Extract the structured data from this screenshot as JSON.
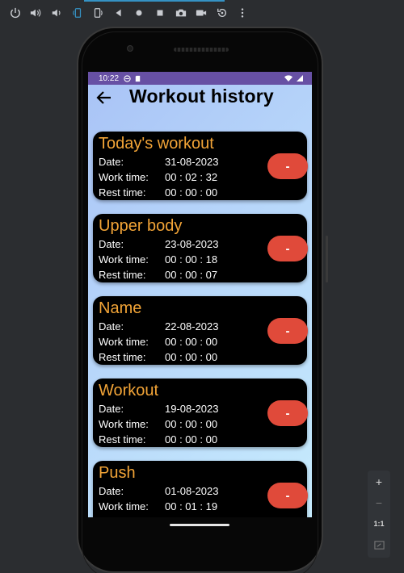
{
  "emulator": {
    "toolbar_icons": [
      "power-icon",
      "volume-up-icon",
      "volume-down-icon",
      "rotate-left-icon",
      "rotate-right-icon",
      "back-icon",
      "home-icon",
      "overview-icon",
      "camera-icon",
      "video-icon",
      "replay-icon",
      "more-icon"
    ],
    "accent": "#3592c4"
  },
  "statusbar": {
    "time": "10:22",
    "color": "#6750a4"
  },
  "appbar": {
    "title": "Workout history"
  },
  "labels": {
    "date": "Date:",
    "work": "Work time:",
    "rest": "Rest time:",
    "delete": "-"
  },
  "workouts": [
    {
      "name": "Today's workout",
      "date": "31-08-2023",
      "work": "00 : 02 : 32",
      "rest": "00 : 00 : 00"
    },
    {
      "name": "Upper body",
      "date": "23-08-2023",
      "work": "00 : 00 : 18",
      "rest": "00 : 00 : 07"
    },
    {
      "name": "Name",
      "date": "22-08-2023",
      "work": "00 : 00 : 00",
      "rest": "00 : 00 : 00"
    },
    {
      "name": "Workout",
      "date": "19-08-2023",
      "work": "00 : 00 : 00",
      "rest": "00 : 00 : 00"
    },
    {
      "name": "Push",
      "date": "01-08-2023",
      "work": "00 : 01 : 19",
      "rest": ""
    }
  ],
  "colors": {
    "name_text": "#f2a437",
    "delete_button": "#e04a3a",
    "card": "#000000"
  },
  "zoom": {
    "plus": "+",
    "minus": "−",
    "one_to_one": "1:1"
  }
}
